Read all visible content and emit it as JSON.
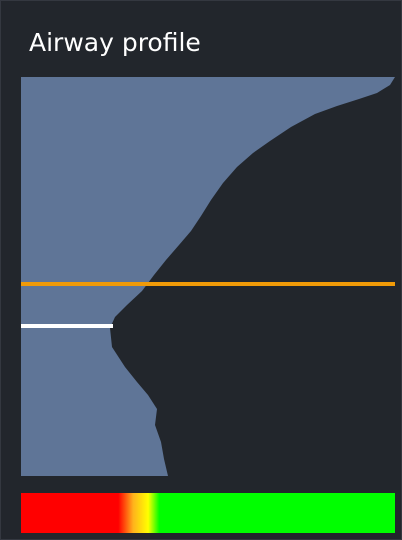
{
  "panel": {
    "title": "Airway profile"
  },
  "profile_view": {
    "colors": {
      "background": "#22262c",
      "airway_fill": "#5f7597",
      "orange_line": "#f09a08",
      "white_line": "#ffffff"
    }
  },
  "color_scale": {
    "stops": [
      {
        "position": 0.0,
        "color": "#ff0000"
      },
      {
        "position": 0.26,
        "color": "#ff0000"
      },
      {
        "position": 0.3,
        "color": "#ffb21c"
      },
      {
        "position": 0.34,
        "color": "#ffff00"
      },
      {
        "position": 0.37,
        "color": "#00ff00"
      },
      {
        "position": 1.0,
        "color": "#00ff00"
      }
    ]
  }
}
